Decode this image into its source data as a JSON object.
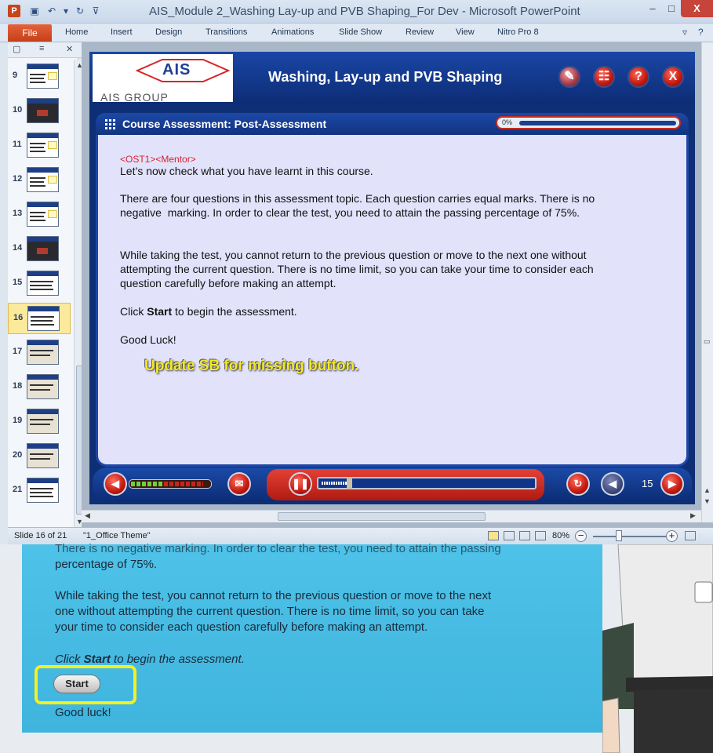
{
  "window": {
    "title": "AIS_Module 2_Washing Lay-up and PVB Shaping_For Dev - Microsoft PowerPoint",
    "app_icon": "P",
    "minimize": "–",
    "maximize": "□",
    "close": "X"
  },
  "ribbon": {
    "file": "File",
    "tabs": [
      "Home",
      "Insert",
      "Design",
      "Transitions",
      "Animations",
      "Slide Show",
      "Review",
      "View",
      "Nitro Pro 8"
    ]
  },
  "thumbnails": {
    "items": [
      {
        "num": "9"
      },
      {
        "num": "10"
      },
      {
        "num": "11"
      },
      {
        "num": "12"
      },
      {
        "num": "13"
      },
      {
        "num": "14"
      },
      {
        "num": "15"
      },
      {
        "num": "16"
      },
      {
        "num": "17"
      },
      {
        "num": "18"
      },
      {
        "num": "19"
      },
      {
        "num": "20"
      },
      {
        "num": "21"
      }
    ],
    "selected": "16"
  },
  "slide": {
    "logo_text": "AIS",
    "logo_group": "AIS GROUP",
    "course_title": "Washing, Lay-up and PVB Shaping",
    "assessment_title": "Course Assessment:  Post-Assessment",
    "progress_label": "0%",
    "progress_value": 0,
    "mentor_tag": "<OST1><Mentor>",
    "line1": "Let’s now check what you have learnt in this course.",
    "para2a": "There are four questions in this assessment topic. Each question carries equal marks. There is no",
    "para2b": "negative  marking. In order to clear the test, you need to attain the passing percentage of 75%.",
    "para3a": "While taking the test, you cannot return to the previous question or move to the next one without",
    "para3b": "attempting the current question. There is no time limit, so you can take your time to consider each",
    "para3c": "question carefully before making an attempt.",
    "click_pre": "Click ",
    "click_bold": "Start",
    "click_post": " to begin the assessment.",
    "good_luck": "Good Luck!",
    "note": "Update SB for missing button.",
    "slide_number": "15"
  },
  "status": {
    "slide": "Slide 16 of 21",
    "theme": "\"1_Office Theme\"",
    "zoom": "80%"
  },
  "lower": {
    "line0": "There is no negative marking. In order to clear the test, you need to attain the passing",
    "line1": "percentage of 75%.",
    "line2": "While taking the test, you cannot return to the previous question or move to the next",
    "line3": "one without attempting the current question. There is no time limit, so you can take",
    "line4": "your time to consider each question carefully before making an attempt.",
    "click_pre": "Click ",
    "click_bold": "Start",
    "click_post": " to begin the assessment.",
    "start_button": "Start",
    "good_luck": "Good luck!"
  },
  "colors": {
    "accent_red": "#c01810",
    "slide_blue": "#0e2f76",
    "highlight_yellow": "#f5f01f",
    "note_yellow": "#f3e92a"
  }
}
